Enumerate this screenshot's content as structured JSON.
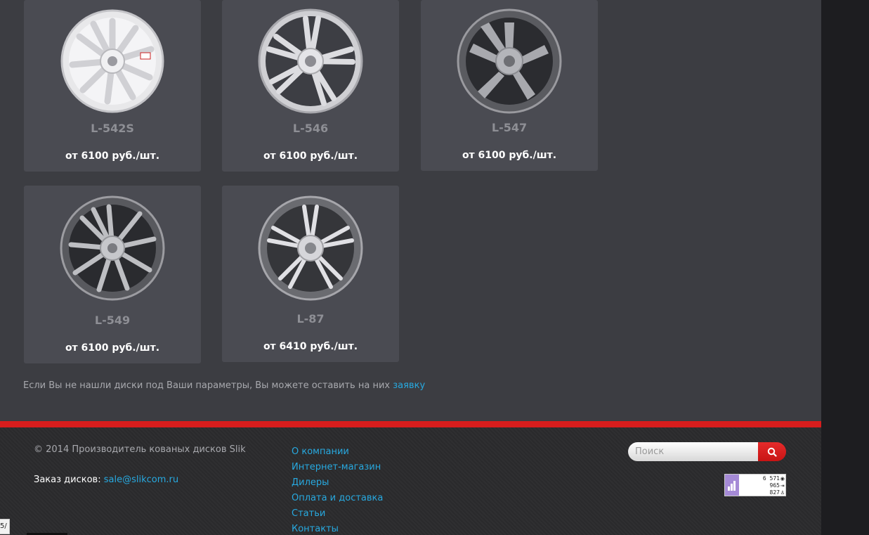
{
  "products": [
    {
      "model": "L-542S",
      "price": "от 6100 руб./шт."
    },
    {
      "model": "L-546",
      "price": "от 6100 руб./шт."
    },
    {
      "model": "L-547",
      "price": "от 6100 руб./шт."
    },
    {
      "model": "L-549",
      "price": "от 6100 руб./шт."
    },
    {
      "model": "L-87",
      "price": "от 6410 руб./шт."
    }
  ],
  "notice": {
    "text": "Если Вы не нашли диски под Ваши параметры, Вы можете оставить на них ",
    "link": "заявку"
  },
  "footer": {
    "copyright": "© 2014 Производитель кованых дисков Slik",
    "order_label": "Заказ дисков: ",
    "order_email": "sale@slikcom.ru",
    "nav": [
      "О компании",
      "Интернет-магазин",
      "Дилеры",
      "Оплата и доставка",
      "Статьи",
      "Контакты"
    ],
    "search_placeholder": "Поиск",
    "counter": {
      "views": "6 571",
      "visits": "965",
      "visitors": "827"
    }
  },
  "edge_label": "5/",
  "colors": {
    "accent": "#27a9e0",
    "brand_red": "#d71d1d",
    "card_bg": "#4a4b52",
    "page_bg": "#3c3d42"
  },
  "icons": {
    "search": "magnifier-icon",
    "counter": "metrika-icon"
  }
}
